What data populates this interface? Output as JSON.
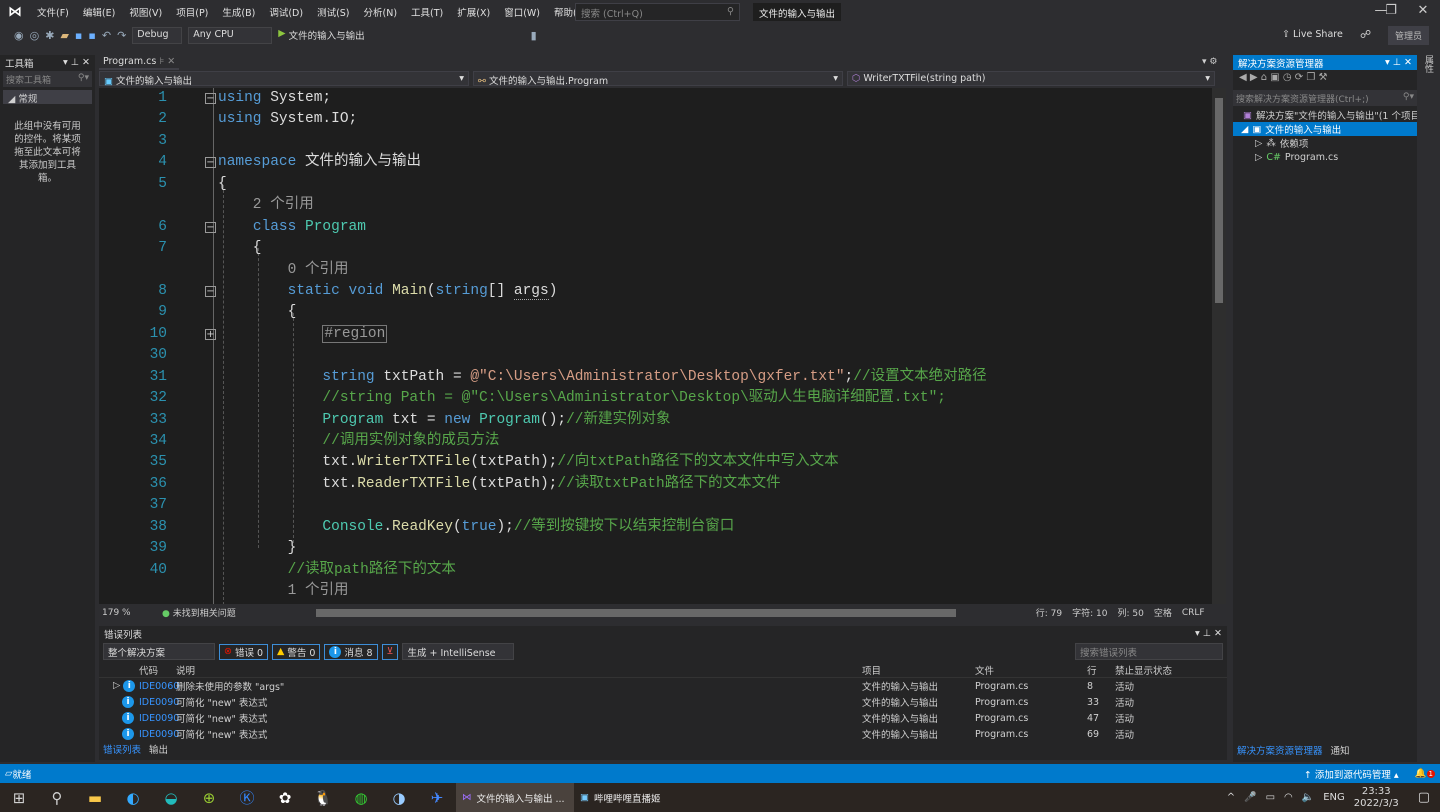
{
  "menubar": {
    "items": [
      "文件(F)",
      "编辑(E)",
      "视图(V)",
      "项目(P)",
      "生成(B)",
      "调试(D)",
      "测试(S)",
      "分析(N)",
      "工具(T)",
      "扩展(X)",
      "窗口(W)",
      "帮助(H)"
    ],
    "search_placeholder": "搜索 (Ctrl+Q)",
    "title": "文件的输入与输出"
  },
  "toolbar": {
    "config": "Debug",
    "platform": "Any CPU",
    "start": "文件的输入与输出",
    "live_share": "Live Share",
    "admin": "管理员"
  },
  "toolbox": {
    "title": "工具箱",
    "search_placeholder": "搜索工具箱",
    "group": "常规",
    "empty_text": "此组中没有可用的控件。将某项拖至此文本可将其添加到工具箱。"
  },
  "editor": {
    "tab": "Program.cs",
    "nav": {
      "project": "文件的输入与输出",
      "class": "文件的输入与输出.Program",
      "member": "WriterTXTFile(string path)"
    },
    "rows": [
      {
        "n": "1",
        "fold": "−",
        "t": [
          [
            "kw",
            "using"
          ],
          [
            "p",
            " System;"
          ]
        ]
      },
      {
        "n": "2",
        "t": [
          [
            "kw",
            "using"
          ],
          [
            "p",
            " System.IO;"
          ]
        ]
      },
      {
        "n": "3",
        "t": []
      },
      {
        "n": "4",
        "fold": "−",
        "t": [
          [
            "kw",
            "namespace"
          ],
          [
            "p",
            " 文件的输入与输出"
          ]
        ]
      },
      {
        "n": "5",
        "t": [
          [
            "p",
            "{"
          ]
        ]
      },
      {
        "n": "",
        "t": [
          [
            "ref",
            "    2 个引用"
          ]
        ]
      },
      {
        "n": "6",
        "fold": "−",
        "t": [
          [
            "p",
            "    "
          ],
          [
            "kw",
            "class"
          ],
          [
            "p",
            " "
          ],
          [
            "type",
            "Program"
          ]
        ]
      },
      {
        "n": "7",
        "t": [
          [
            "p",
            "    {"
          ]
        ]
      },
      {
        "n": "",
        "t": [
          [
            "ref",
            "        0 个引用"
          ]
        ]
      },
      {
        "n": "8",
        "fold": "−",
        "t": [
          [
            "p",
            "        "
          ],
          [
            "kw",
            "static"
          ],
          [
            "p",
            " "
          ],
          [
            "kw",
            "void"
          ],
          [
            "p",
            " "
          ],
          [
            "fn",
            "Main"
          ],
          [
            "p",
            "("
          ],
          [
            "kw",
            "string"
          ],
          [
            "p",
            "[] "
          ],
          [
            "unused",
            "args"
          ],
          [
            "p",
            ")"
          ]
        ]
      },
      {
        "n": "9",
        "t": [
          [
            "p",
            "        {"
          ]
        ]
      },
      {
        "n": "10",
        "fold": "+",
        "t": [
          [
            "p",
            "            "
          ],
          [
            "region",
            "#region"
          ]
        ]
      },
      {
        "n": "30",
        "t": []
      },
      {
        "n": "31",
        "t": [
          [
            "p",
            "            "
          ],
          [
            "kw",
            "string"
          ],
          [
            "p",
            " txtPath = "
          ],
          [
            "str",
            "@\"C:\\Users\\Administrator\\Desktop\\gxfer.txt\""
          ],
          [
            "p",
            ";"
          ],
          [
            "cm",
            "//设置文本绝对路径"
          ]
        ]
      },
      {
        "n": "32",
        "t": [
          [
            "p",
            "            "
          ],
          [
            "cm",
            "//string Path = @\"C:\\Users\\Administrator\\Desktop\\驱动人生电脑详细配置.txt\";"
          ]
        ]
      },
      {
        "n": "33",
        "t": [
          [
            "p",
            "            "
          ],
          [
            "type",
            "Program"
          ],
          [
            "p",
            " txt = "
          ],
          [
            "kw",
            "new"
          ],
          [
            "p",
            " "
          ],
          [
            "type",
            "Program"
          ],
          [
            "p",
            "();"
          ],
          [
            "cm",
            "//新建实例对象"
          ]
        ]
      },
      {
        "n": "34",
        "t": [
          [
            "p",
            "            "
          ],
          [
            "cm",
            "//调用实例对象的成员方法"
          ]
        ]
      },
      {
        "n": "35",
        "t": [
          [
            "p",
            "            txt."
          ],
          [
            "fn",
            "WriterTXTFile"
          ],
          [
            "p",
            "(txtPath);"
          ],
          [
            "cm",
            "//向txtPath路径下的文本文件中写入文本"
          ]
        ]
      },
      {
        "n": "36",
        "t": [
          [
            "p",
            "            txt."
          ],
          [
            "fn",
            "ReaderTXTFile"
          ],
          [
            "p",
            "(txtPath);"
          ],
          [
            "cm",
            "//读取txtPath路径下的文本文件"
          ]
        ]
      },
      {
        "n": "37",
        "t": []
      },
      {
        "n": "38",
        "t": [
          [
            "p",
            "            "
          ],
          [
            "type",
            "Console"
          ],
          [
            "p",
            "."
          ],
          [
            "fn",
            "ReadKey"
          ],
          [
            "p",
            "("
          ],
          [
            "kw",
            "true"
          ],
          [
            "p",
            ");"
          ],
          [
            "cm",
            "//等到按键按下以结束控制台窗口"
          ]
        ]
      },
      {
        "n": "39",
        "t": [
          [
            "p",
            "        }"
          ]
        ]
      },
      {
        "n": "40",
        "t": [
          [
            "p",
            "        "
          ],
          [
            "cm",
            "//读取path路径下的文本"
          ]
        ]
      },
      {
        "n": "",
        "t": [
          [
            "ref",
            "        1 个引用"
          ]
        ]
      }
    ],
    "status": {
      "zoom": "179 %",
      "issues": "未找到相关问题",
      "line": "行: 79",
      "char": "字符: 10",
      "col": "列: 50",
      "spaces": "空格",
      "eol": "CRLF"
    }
  },
  "error_list": {
    "title": "错误列表",
    "scope": "整个解决方案",
    "errors": "错误 0",
    "warnings": "警告 0",
    "messages": "消息 8",
    "source": "生成 + IntelliSense",
    "search_placeholder": "搜索错误列表",
    "columns": [
      "代码",
      "说明",
      "项目",
      "文件",
      "行",
      "禁止显示状态"
    ],
    "rows": [
      {
        "code": "IDE0060",
        "desc": "删除未使用的参数 \"args\"",
        "project": "文件的输入与输出",
        "file": "Program.cs",
        "line": "8",
        "state": "活动"
      },
      {
        "code": "IDE0090",
        "desc": "可简化 \"new\" 表达式",
        "project": "文件的输入与输出",
        "file": "Program.cs",
        "line": "33",
        "state": "活动"
      },
      {
        "code": "IDE0090",
        "desc": "可简化 \"new\" 表达式",
        "project": "文件的输入与输出",
        "file": "Program.cs",
        "line": "47",
        "state": "活动"
      },
      {
        "code": "IDE0090",
        "desc": "可简化 \"new\" 表达式",
        "project": "文件的输入与输出",
        "file": "Program.cs",
        "line": "69",
        "state": "活动"
      }
    ],
    "tabs": [
      "错误列表",
      "输出"
    ]
  },
  "solution": {
    "title": "解决方案资源管理器",
    "search_placeholder": "搜索解决方案资源管理器(Ctrl+;)",
    "solution_node": "解决方案\"文件的输入与输出\"(1 个项目/",
    "project_node": "文件的输入与输出",
    "deps": "依赖项",
    "file": "Program.cs",
    "tabs": [
      "解决方案资源管理器",
      "通知"
    ],
    "side_tab": "属性"
  },
  "statusbar": {
    "ready": "就绪",
    "source_control": "添加到源代码管理",
    "notifications": "1"
  },
  "taskbar": {
    "apps": [
      {
        "label": "文件的输入与输出 ..."
      },
      {
        "label": "哔哩哔哩直播姬"
      }
    ],
    "lang": "ENG",
    "time": "23:33",
    "date": "2022/3/3"
  },
  "colors": {
    "accent": "#007acc",
    "keyword": "#569cd6",
    "type": "#4ec9b0",
    "string": "#d69d85",
    "comment": "#57a64a"
  }
}
